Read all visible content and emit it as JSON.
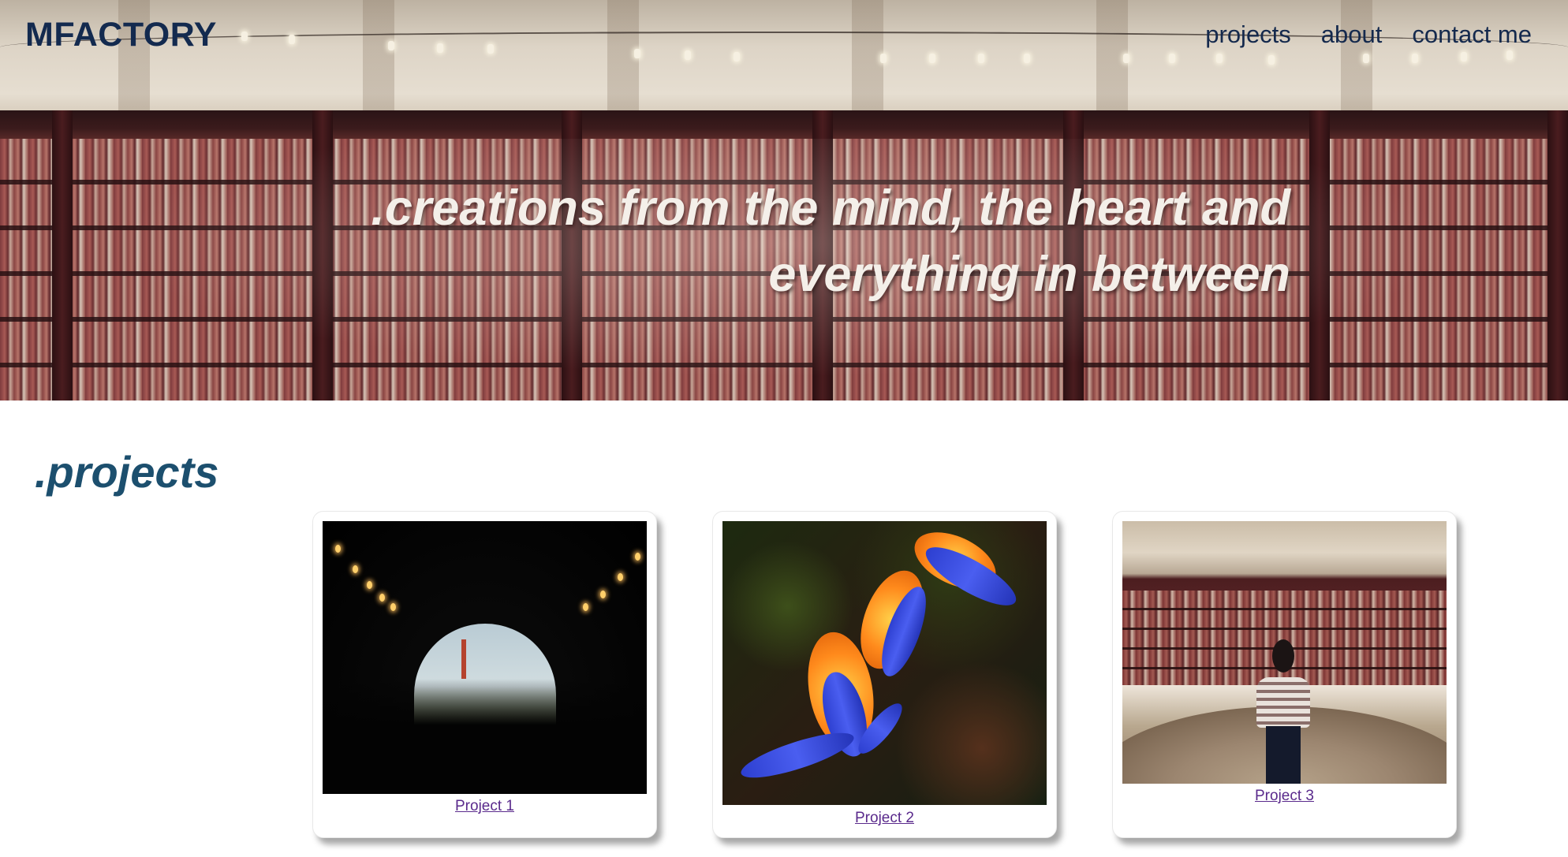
{
  "header": {
    "brand": "MFACTORY",
    "nav": [
      {
        "label": "projects"
      },
      {
        "label": "about"
      },
      {
        "label": "contact me"
      }
    ]
  },
  "hero": {
    "tagline_line1": ".creations from the mind, the heart and",
    "tagline_line2": "everything in between"
  },
  "projects": {
    "title": ".projects",
    "items": [
      {
        "label": "Project 1",
        "image": "tunnel-photo"
      },
      {
        "label": "Project 2",
        "image": "nudibranch-photo"
      },
      {
        "label": "Project 3",
        "image": "library-photo"
      }
    ]
  },
  "colors": {
    "brand": "#132a4f",
    "section_title": "#1c4f6e",
    "link": "#5a2a8c"
  }
}
